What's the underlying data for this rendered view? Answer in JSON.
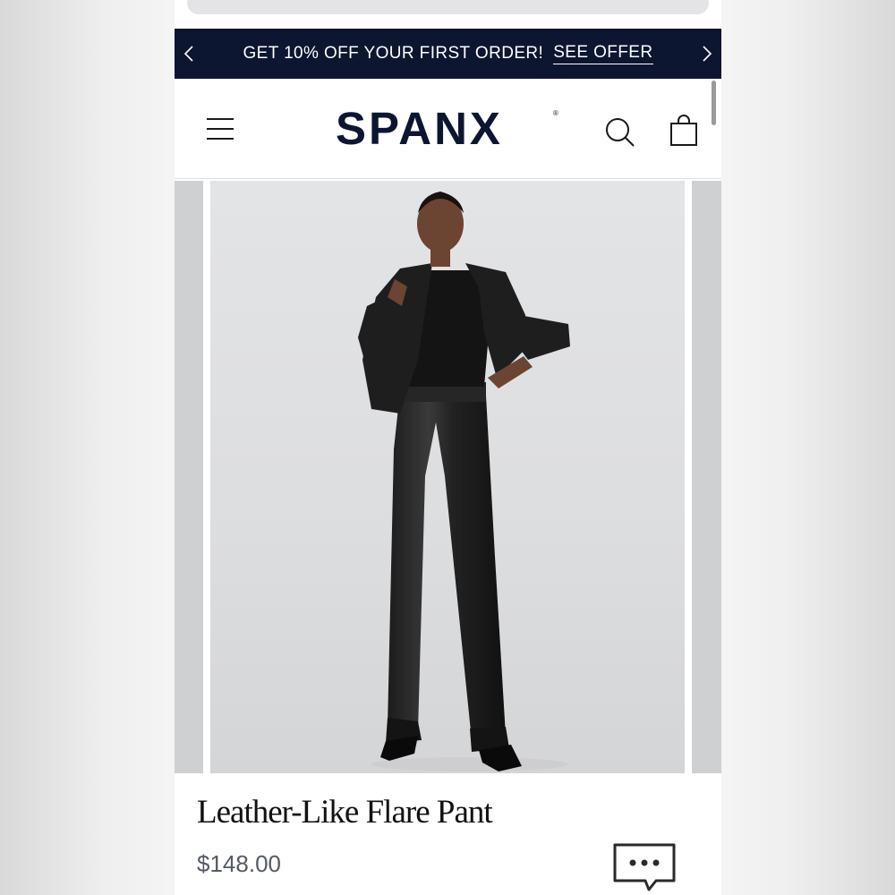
{
  "promo": {
    "text": "GET 10% OFF YOUR FIRST ORDER!",
    "link": "SEE OFFER"
  },
  "header": {
    "brand": "SPANX",
    "trademark": "®"
  },
  "product": {
    "title": "Leather-Like Flare Pant",
    "price": "$148.00"
  },
  "icons": {
    "prev": "chevron-left-icon",
    "next": "chevron-right-icon",
    "menu": "hamburger-menu-icon",
    "search": "search-icon",
    "bag": "shopping-bag-icon",
    "chat": "chat-bubble-icon"
  },
  "colors": {
    "navy": "#0d1630",
    "price_gray": "#555a63"
  }
}
